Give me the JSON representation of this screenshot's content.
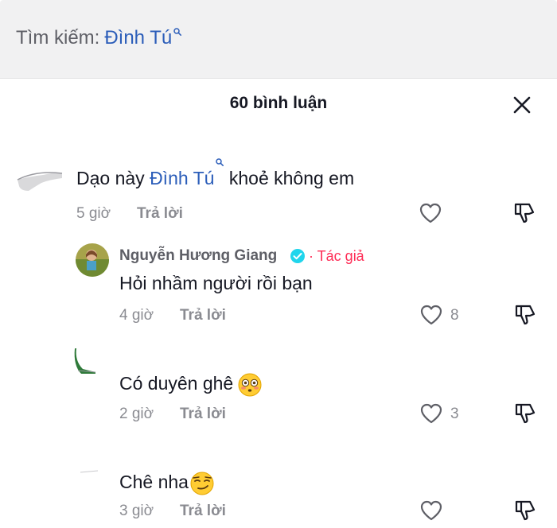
{
  "search": {
    "prefix": "Tìm kiếm:",
    "keyword": "Đình Tú"
  },
  "header": {
    "comment_count": "60 bình luận"
  },
  "comments": [
    {
      "text_before": "Dạo này",
      "keyword": "Đình Tú",
      "text_after": "khoẻ không em",
      "time": "5 giờ",
      "reply_label": "Trả lời",
      "likes": ""
    },
    {
      "username": "Nguyễn Hương Giang",
      "author_badge": "· Tác giả",
      "text": "Hỏi nhầm người rồi bạn",
      "time": "4 giờ",
      "reply_label": "Trả lời",
      "likes": "8"
    },
    {
      "text": "Có duyên ghê",
      "time": "2 giờ",
      "reply_label": "Trả lời",
      "likes": "3",
      "emoji": "flushed-face-emoji"
    },
    {
      "text": "Chê nha",
      "time": "3 giờ",
      "reply_label": "Trả lời",
      "likes": "",
      "emoji": "smirking-face-emoji"
    }
  ],
  "colors": {
    "keyword": "#2b5db9",
    "author_badge": "#fe2c55",
    "verified": "#20d5ec",
    "muted": "#8a8b91"
  },
  "icons": [
    "search-icon",
    "close-icon",
    "heart-icon",
    "dislike-icon",
    "verified-icon"
  ]
}
